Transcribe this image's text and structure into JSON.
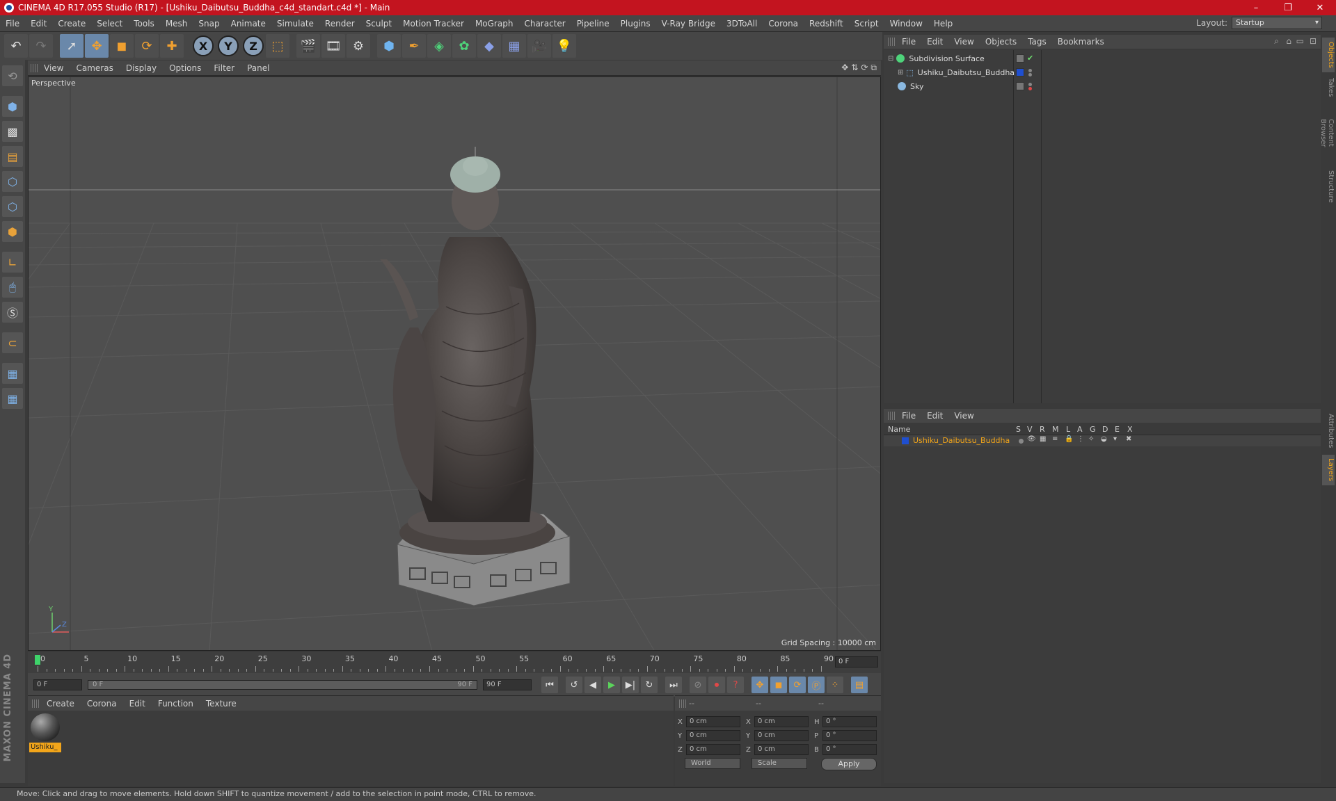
{
  "window": {
    "title": "CINEMA 4D R17.055 Studio (R17) - [Ushiku_Daibutsu_Buddha_c4d_standart.c4d *] - Main",
    "controls": [
      "–",
      "❐",
      "✕"
    ]
  },
  "menubar": {
    "items": [
      "File",
      "Edit",
      "Create",
      "Select",
      "Tools",
      "Mesh",
      "Snap",
      "Animate",
      "Simulate",
      "Render",
      "Sculpt",
      "Motion Tracker",
      "MoGraph",
      "Character",
      "Pipeline",
      "Plugins",
      "V-Ray Bridge",
      "3DToAll",
      "Corona",
      "Redshift",
      "Script",
      "Window",
      "Help"
    ],
    "layout_label": "Layout:",
    "layout_value": "Startup"
  },
  "toolbar": {
    "axis": [
      "X",
      "Y",
      "Z"
    ]
  },
  "viewport": {
    "menu": [
      "View",
      "Cameras",
      "Display",
      "Options",
      "Filter",
      "Panel"
    ],
    "label": "Perspective",
    "grid_spacing": "Grid Spacing : 10000 cm"
  },
  "timeline": {
    "ticks": [
      "0",
      "5",
      "10",
      "15",
      "20",
      "25",
      "30",
      "35",
      "40",
      "45",
      "50",
      "55",
      "60",
      "65",
      "70",
      "75",
      "80",
      "85",
      "90"
    ],
    "current_frame": "0 F"
  },
  "transport": {
    "start": "0 F",
    "slider_left": "0 F",
    "slider_right": "90 F",
    "end": "90 F"
  },
  "material_manager": {
    "menu": [
      "Create",
      "Corona",
      "Edit",
      "Function",
      "Texture"
    ],
    "material_name": "Ushiku_"
  },
  "coordinates": {
    "header": [
      "--",
      "--",
      "--"
    ],
    "rows": [
      {
        "a": "X",
        "av": "0 cm",
        "b": "X",
        "bv": "0 cm",
        "c": "H",
        "cv": "0 °"
      },
      {
        "a": "Y",
        "av": "0 cm",
        "b": "Y",
        "bv": "0 cm",
        "c": "P",
        "cv": "0 °"
      },
      {
        "a": "Z",
        "av": "0 cm",
        "b": "Z",
        "bv": "0 cm",
        "c": "B",
        "cv": "0 °"
      }
    ],
    "world": "World",
    "scale": "Scale",
    "apply": "Apply"
  },
  "object_manager": {
    "menu": [
      "File",
      "Edit",
      "View",
      "Objects",
      "Tags",
      "Bookmarks"
    ],
    "objects": [
      "Subdivision Surface",
      "Ushiku_Daibutsu_Buddha",
      "Sky"
    ]
  },
  "layer_manager": {
    "menu": [
      "File",
      "Edit",
      "View"
    ],
    "columns": [
      "Name",
      "S",
      "V",
      "R",
      "M",
      "L",
      "A",
      "G",
      "D",
      "E",
      "X"
    ],
    "layer_name": "Ushiku_Daibutsu_Buddha"
  },
  "right_tabs": [
    "Objects",
    "Takes",
    "Content Browser",
    "Structure",
    "Attributes",
    "Layers"
  ],
  "status": "Move: Click and drag to move elements. Hold down SHIFT to quantize movement / add to the selection in point mode, CTRL to remove.",
  "maxon": "MAXON CINEMA 4D",
  "colors": {
    "titlebar": "#c3141f",
    "accent": "#f2a51a",
    "selection": "#6a88aa"
  }
}
